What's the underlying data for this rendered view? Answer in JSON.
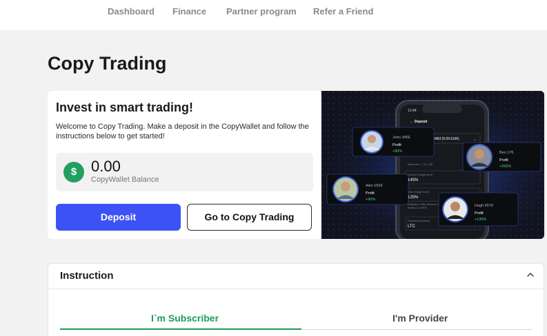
{
  "nav": {
    "items": [
      {
        "label": "Dashboard"
      },
      {
        "label": "Finance"
      },
      {
        "label": "Partner program"
      },
      {
        "label": "Refer a Friend"
      }
    ]
  },
  "page": {
    "title": "Copy Trading"
  },
  "hero": {
    "title": "Invest in smart trading!",
    "description": "Welcome to Copy Trading. Make a deposit in the CopyWallet and follow the instructions below to get started!",
    "balance": {
      "icon": "dollar-icon",
      "symbol": "$",
      "value": "0.00",
      "label": "CopyWallet Balance"
    },
    "deposit_label": "Deposit",
    "copy_trading_label": "Go to Copy Trading",
    "illustration": {
      "phone": {
        "time": "13:48",
        "screen_title": "Deposit",
        "amount": "6483 (0.09 EUR)",
        "field_current_margin_label": "Current margin level",
        "field_current_margin": "145%",
        "field_new_margin_label": "New margin level",
        "field_new_margin": "125%",
        "field_payment_label": "Payment currency",
        "field_payment": "LTC"
      },
      "traders": [
        {
          "name": "John 3456",
          "profit_label": "Profit",
          "profit": "+90%"
        },
        {
          "name": "Ben 176",
          "profit_label": "Profit",
          "profit": "+250%"
        },
        {
          "name": "Alex 1554",
          "profit_label": "Profit",
          "profit": "+90%"
        },
        {
          "name": "Hugh 6579",
          "profit_label": "Profit",
          "profit": "+130%"
        }
      ]
    }
  },
  "instruction": {
    "title": "Instruction",
    "tabs": [
      {
        "label": "I`m Subscriber",
        "active": true
      },
      {
        "label": "I'm Provider",
        "active": false
      }
    ]
  },
  "colors": {
    "accent_blue": "#3d52f5",
    "accent_green": "#1f9a5a",
    "profit_green": "#3ddc84"
  }
}
